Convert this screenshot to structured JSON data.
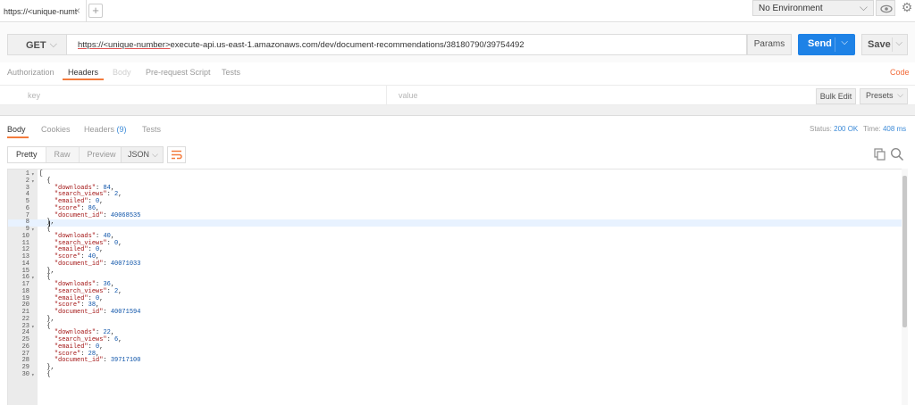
{
  "request_tab": {
    "label": "https://<unique-numt"
  },
  "environment": {
    "selected": "No Environment"
  },
  "url_bar": {
    "method": "GET",
    "url_prefix": "https://<unique-number>",
    "url_rest": "execute-api.us-east-1.amazonaws.com/dev/document-recommendations/38180790/39754492",
    "params_label": "Params",
    "send_label": "Send",
    "save_label": "Save"
  },
  "request_tabs": [
    "Authorization",
    "Headers",
    "Body",
    "Pre-request Script",
    "Tests"
  ],
  "code_link": "Code",
  "headers_editor": {
    "key_placeholder": "key",
    "value_placeholder": "value",
    "bulk_edit_label": "Bulk Edit",
    "presets_label": "Presets"
  },
  "response": {
    "tabs": {
      "body": "Body",
      "cookies": "Cookies",
      "headers": "Headers",
      "headers_count": "(9)",
      "tests": "Tests"
    },
    "status_label": "Status:",
    "status_value": "200 OK",
    "time_label": "Time:",
    "time_value": "408 ms",
    "view_modes": [
      "Pretty",
      "Raw",
      "Preview"
    ],
    "format": "JSON"
  },
  "code_lines": [
    {
      "n": "1",
      "fold": true,
      "text": "["
    },
    {
      "n": "2",
      "fold": true,
      "text": "  {"
    },
    {
      "n": "3",
      "key": "downloads",
      "val": "84",
      "comma": true
    },
    {
      "n": "4",
      "key": "search_views",
      "val": "2",
      "comma": true
    },
    {
      "n": "5",
      "key": "emailed",
      "val": "0",
      "comma": true
    },
    {
      "n": "6",
      "key": "score",
      "val": "86",
      "comma": true
    },
    {
      "n": "7",
      "key": "document_id",
      "val": "40068535",
      "comma": false
    },
    {
      "n": "8",
      "text": "  },",
      "highlight": true
    },
    {
      "n": "9",
      "fold": true,
      "text": "  {"
    },
    {
      "n": "10",
      "key": "downloads",
      "val": "40",
      "comma": true
    },
    {
      "n": "11",
      "key": "search_views",
      "val": "0",
      "comma": true
    },
    {
      "n": "12",
      "key": "emailed",
      "val": "0",
      "comma": true
    },
    {
      "n": "13",
      "key": "score",
      "val": "40",
      "comma": true
    },
    {
      "n": "14",
      "key": "document_id",
      "val": "40071033",
      "comma": false
    },
    {
      "n": "15",
      "text": "  },"
    },
    {
      "n": "16",
      "fold": true,
      "text": "  {"
    },
    {
      "n": "17",
      "key": "downloads",
      "val": "36",
      "comma": true
    },
    {
      "n": "18",
      "key": "search_views",
      "val": "2",
      "comma": true
    },
    {
      "n": "19",
      "key": "emailed",
      "val": "0",
      "comma": true
    },
    {
      "n": "20",
      "key": "score",
      "val": "38",
      "comma": true
    },
    {
      "n": "21",
      "key": "document_id",
      "val": "40071594",
      "comma": false
    },
    {
      "n": "22",
      "text": "  },"
    },
    {
      "n": "23",
      "fold": true,
      "text": "  {"
    },
    {
      "n": "24",
      "key": "downloads",
      "val": "22",
      "comma": true
    },
    {
      "n": "25",
      "key": "search_views",
      "val": "6",
      "comma": true
    },
    {
      "n": "26",
      "key": "emailed",
      "val": "0",
      "comma": true
    },
    {
      "n": "27",
      "key": "score",
      "val": "28",
      "comma": true
    },
    {
      "n": "28",
      "key": "document_id",
      "val": "39717100",
      "comma": false
    },
    {
      "n": "29",
      "text": "  },"
    },
    {
      "n": "30",
      "fold": true,
      "text": "  {"
    }
  ]
}
